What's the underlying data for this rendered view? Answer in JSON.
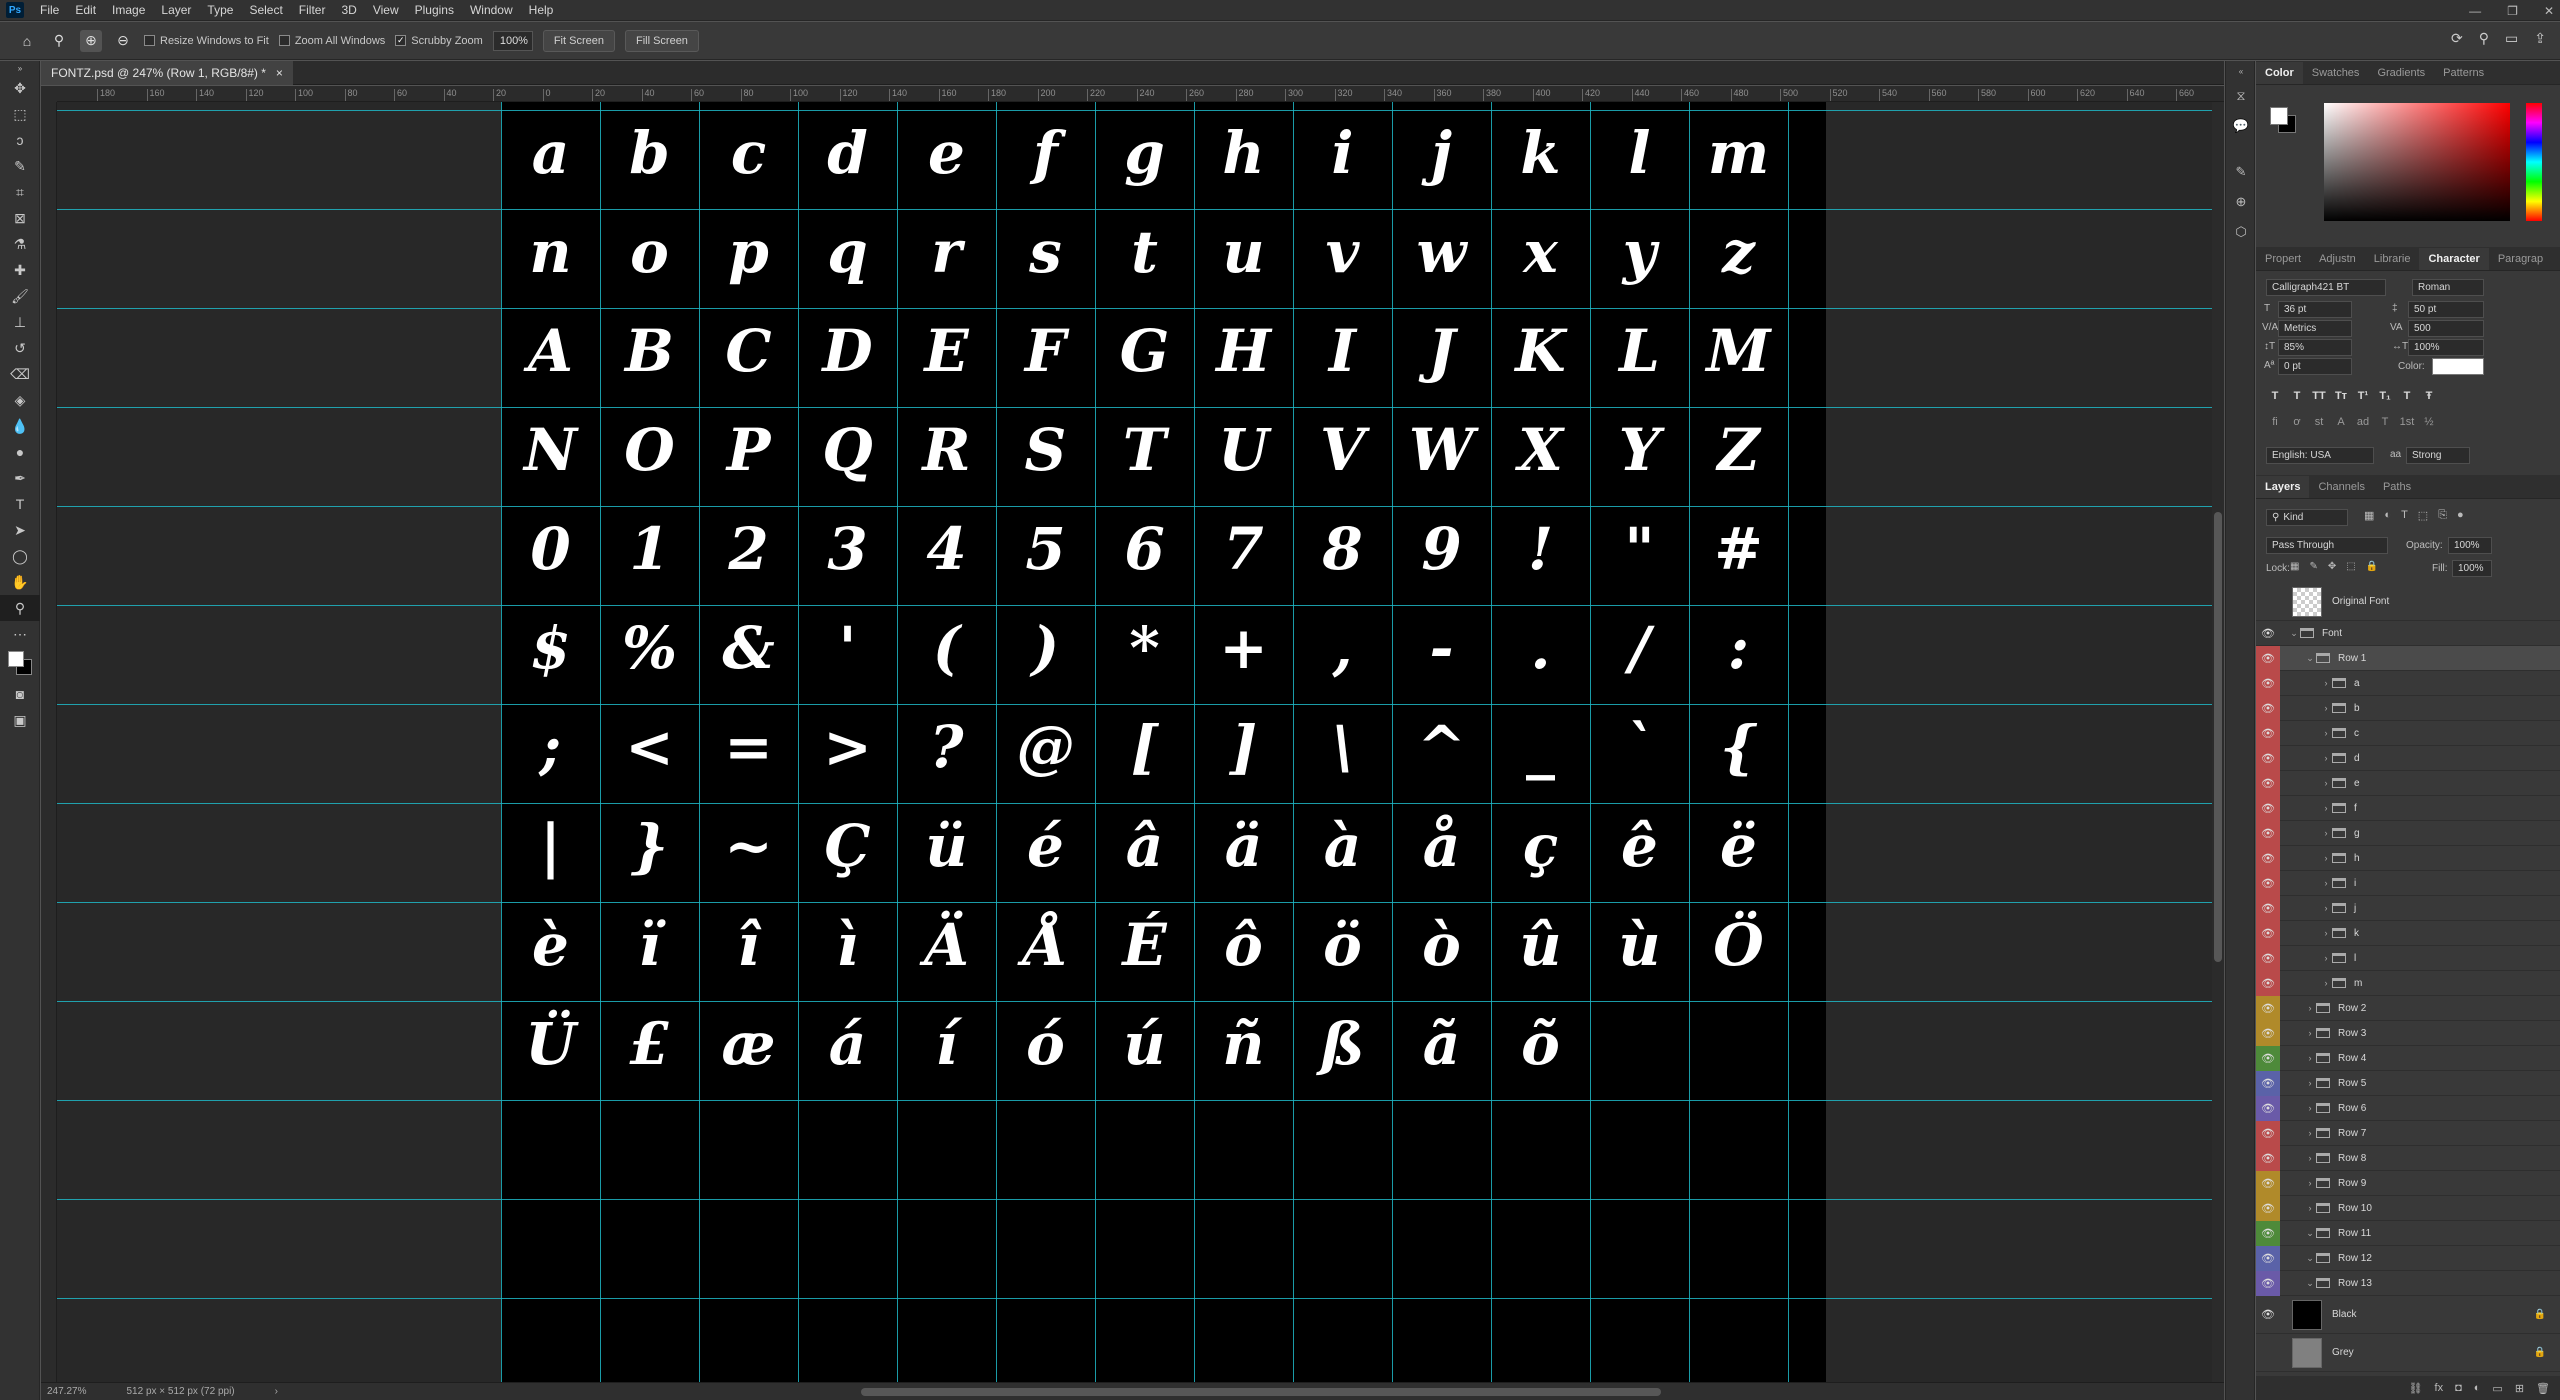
{
  "app": {
    "logo": "Ps"
  },
  "menu": [
    "File",
    "Edit",
    "Image",
    "Layer",
    "Type",
    "Select",
    "Filter",
    "3D",
    "View",
    "Plugins",
    "Window",
    "Help"
  ],
  "window_controls": [
    "—",
    "❐",
    "✕"
  ],
  "options": {
    "resize_windows": "Resize Windows to Fit",
    "zoom_all": "Zoom All Windows",
    "scrubby_zoom": "Scrubby Zoom",
    "zoom_value": "100%",
    "fit_screen": "Fit Screen",
    "fill_screen": "Fill Screen"
  },
  "document": {
    "tab_title": "FONTZ.psd @ 247% (Row 1, RGB/8#) *",
    "close": "×"
  },
  "ruler_labels": [
    "180",
    "160",
    "140",
    "120",
    "100",
    "80",
    "60",
    "40",
    "20",
    "0",
    "20",
    "40",
    "60",
    "80",
    "100",
    "120",
    "140",
    "160",
    "180",
    "200",
    "220",
    "240",
    "260",
    "280",
    "300",
    "320",
    "340",
    "360",
    "380",
    "400",
    "420",
    "440",
    "460",
    "480",
    "500",
    "520",
    "540",
    "560",
    "580",
    "600",
    "620",
    "640",
    "660",
    "680"
  ],
  "glyph_rows": [
    [
      "a",
      "b",
      "c",
      "d",
      "e",
      "f",
      "g",
      "h",
      "i",
      "j",
      "k",
      "l",
      "m"
    ],
    [
      "n",
      "o",
      "p",
      "q",
      "r",
      "s",
      "t",
      "u",
      "v",
      "w",
      "x",
      "y",
      "z"
    ],
    [
      "A",
      "B",
      "C",
      "D",
      "E",
      "F",
      "G",
      "H",
      "I",
      "J",
      "K",
      "L",
      "M"
    ],
    [
      "N",
      "O",
      "P",
      "Q",
      "R",
      "S",
      "T",
      "U",
      "V",
      "W",
      "X",
      "Y",
      "Z"
    ],
    [
      "0",
      "1",
      "2",
      "3",
      "4",
      "5",
      "6",
      "7",
      "8",
      "9",
      "!",
      "\"",
      "#"
    ],
    [
      "$",
      "%",
      "&",
      "'",
      "(",
      ")",
      "*",
      "+",
      ",",
      "-",
      ".",
      "/",
      ":"
    ],
    [
      ";",
      "<",
      "=",
      ">",
      "?",
      "@",
      "[",
      "]",
      "\\",
      "^",
      "_",
      "`",
      "{"
    ],
    [
      "|",
      "}",
      "~",
      "Ç",
      "ü",
      "é",
      "â",
      "ä",
      "à",
      "å",
      "ç",
      "ê",
      "ë"
    ],
    [
      "è",
      "ï",
      "î",
      "ì",
      "Ä",
      "Å",
      "É",
      "ô",
      "ö",
      "ò",
      "û",
      "ù",
      "Ö"
    ],
    [
      "Ü",
      "£",
      "æ",
      "á",
      "í",
      "ó",
      "ú",
      "ñ",
      "ß",
      "ã",
      "õ",
      "",
      ""
    ]
  ],
  "status": {
    "zoom": "247.27%",
    "doc_info": "512 px × 512 px (72 ppi)",
    "arrow": "›"
  },
  "color_panel": {
    "tabs": [
      "Color",
      "Swatches",
      "Gradients",
      "Patterns"
    ]
  },
  "character_panel": {
    "tabs": [
      "Propert",
      "Adjustn",
      "Librarie",
      "Character",
      "Paragrap"
    ],
    "font_family": "Calligraph421 BT",
    "font_style": "Roman",
    "font_size": "36 pt",
    "leading": "50 pt",
    "kerning": "Metrics",
    "tracking": "500",
    "vscale": "85%",
    "hscale": "100%",
    "baseline": "0 pt",
    "color_label": "Color:",
    "language": "English: USA",
    "antialias": "Strong",
    "style_buttons": [
      "T",
      "T",
      "TT",
      "Tт",
      "T¹",
      "T₁",
      "T",
      "Ŧ"
    ],
    "ot_buttons": [
      "ﬁ",
      "ơ",
      "st",
      "A",
      "ad",
      "T",
      "1st",
      "½"
    ]
  },
  "layers_panel": {
    "tabs": [
      "Layers",
      "Channels",
      "Paths"
    ],
    "filter": "Kind",
    "blend_mode": "Pass Through",
    "opacity_label": "Opacity:",
    "opacity": "100%",
    "lock_label": "Lock:",
    "fill_label": "Fill:",
    "fill": "100%",
    "layers": [
      {
        "name": "Original Font",
        "type": "thumb",
        "color": "none",
        "visible": false,
        "indent": 0
      },
      {
        "name": "Font",
        "type": "group",
        "color": "none",
        "visible": true,
        "indent": 0,
        "open": true
      },
      {
        "name": "Row 1",
        "type": "group",
        "color": "#b94a4a",
        "visible": true,
        "indent": 1,
        "open": true,
        "selected": true
      },
      {
        "name": "a",
        "type": "group",
        "color": "#b94a4a",
        "visible": true,
        "indent": 2
      },
      {
        "name": "b",
        "type": "group",
        "color": "#b94a4a",
        "visible": true,
        "indent": 2
      },
      {
        "name": "c",
        "type": "group",
        "color": "#b94a4a",
        "visible": true,
        "indent": 2
      },
      {
        "name": "d",
        "type": "group",
        "color": "#b94a4a",
        "visible": true,
        "indent": 2
      },
      {
        "name": "e",
        "type": "group",
        "color": "#b94a4a",
        "visible": true,
        "indent": 2
      },
      {
        "name": "f",
        "type": "group",
        "color": "#b94a4a",
        "visible": true,
        "indent": 2
      },
      {
        "name": "g",
        "type": "group",
        "color": "#b94a4a",
        "visible": true,
        "indent": 2
      },
      {
        "name": "h",
        "type": "group",
        "color": "#b94a4a",
        "visible": true,
        "indent": 2
      },
      {
        "name": "i",
        "type": "group",
        "color": "#b94a4a",
        "visible": true,
        "indent": 2
      },
      {
        "name": "j",
        "type": "group",
        "color": "#b94a4a",
        "visible": true,
        "indent": 2
      },
      {
        "name": "k",
        "type": "group",
        "color": "#b94a4a",
        "visible": true,
        "indent": 2
      },
      {
        "name": "l",
        "type": "group",
        "color": "#b94a4a",
        "visible": true,
        "indent": 2
      },
      {
        "name": "m",
        "type": "group",
        "color": "#b94a4a",
        "visible": true,
        "indent": 2
      },
      {
        "name": "Row 2",
        "type": "group",
        "color": "#b08a2a",
        "visible": true,
        "indent": 1
      },
      {
        "name": "Row 3",
        "type": "group",
        "color": "#b08a2a",
        "visible": true,
        "indent": 1
      },
      {
        "name": "Row 4",
        "type": "group",
        "color": "#4e8a3a",
        "visible": true,
        "indent": 1
      },
      {
        "name": "Row 5",
        "type": "group",
        "color": "#5a62a8",
        "visible": true,
        "indent": 1
      },
      {
        "name": "Row 6",
        "type": "group",
        "color": "#6a5aa8",
        "visible": true,
        "indent": 1
      },
      {
        "name": "Row 7",
        "type": "group",
        "color": "#b94a4a",
        "visible": true,
        "indent": 1
      },
      {
        "name": "Row 8",
        "type": "group",
        "color": "#b94a4a",
        "visible": true,
        "indent": 1
      },
      {
        "name": "Row 9",
        "type": "group",
        "color": "#b08a2a",
        "visible": true,
        "indent": 1
      },
      {
        "name": "Row 10",
        "type": "group",
        "color": "#b08a2a",
        "visible": true,
        "indent": 1
      },
      {
        "name": "Row 11",
        "type": "group",
        "color": "#4e8a3a",
        "visible": true,
        "indent": 1,
        "open": true
      },
      {
        "name": "Row 12",
        "type": "group",
        "color": "#5a62a8",
        "visible": true,
        "indent": 1,
        "open": true
      },
      {
        "name": "Row 13",
        "type": "group",
        "color": "#6a5aa8",
        "visible": true,
        "indent": 1,
        "open": true
      },
      {
        "name": "Black",
        "type": "thumb",
        "color": "none",
        "visible": true,
        "indent": 0,
        "thumb": "#000",
        "locked": true
      },
      {
        "name": "Grey",
        "type": "thumb",
        "color": "none",
        "visible": false,
        "indent": 0,
        "thumb": "#808080",
        "locked": true
      }
    ]
  }
}
